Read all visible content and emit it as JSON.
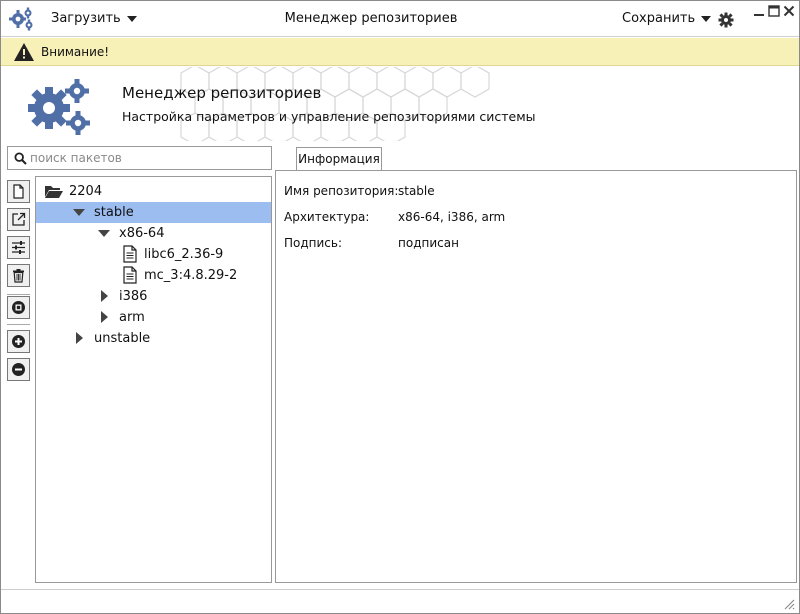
{
  "titlebar": {
    "load_label": "Загрузить",
    "title": "Менеджер репозиториев",
    "save_label": "Сохранить"
  },
  "warning": {
    "text": "Внимание!"
  },
  "header": {
    "title": "Менеджер репозиториев",
    "subtitle": "Настройка параметров и управление репозиториями системы"
  },
  "search": {
    "placeholder": "поиск пакетов",
    "value": ""
  },
  "toolbar": {
    "icons": [
      "new-file-icon",
      "external-link-icon",
      "sliders-icon",
      "trash-icon",
      "stop-icon",
      "add-icon",
      "remove-icon"
    ]
  },
  "tree": {
    "root": {
      "label": "2204",
      "icon": "folder-open-icon"
    },
    "stable": {
      "label": "stable",
      "selected": true
    },
    "x86": {
      "label": "x86-64"
    },
    "file1": {
      "label": "libc6_2.36-9"
    },
    "file2": {
      "label": "mc_3:4.8.29-2"
    },
    "i386": {
      "label": "i386"
    },
    "arm": {
      "label": "arm"
    },
    "unstable": {
      "label": "unstable"
    }
  },
  "tabs": {
    "info_label": "Информация"
  },
  "info": {
    "repo_label": "Имя репозитория:",
    "repo_value": "stable",
    "arch_label": "Архитектура:",
    "arch_value": "x86-64, i386, arm",
    "sign_label": "Подпись:",
    "sign_value": "подписан"
  },
  "colors": {
    "accent_blue": "#4f6fa6",
    "selection": "#9bbdf0",
    "warning_bg": "#f7f1b8"
  }
}
